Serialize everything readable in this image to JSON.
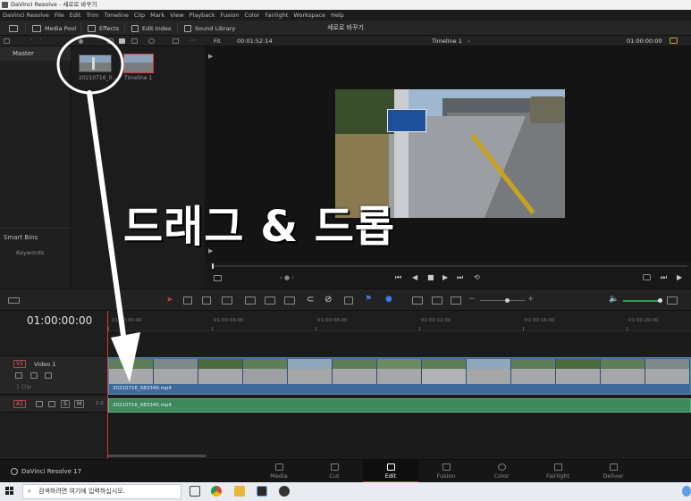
{
  "window": {
    "title": "DaVinci Resolve - 세로로 바꾸기"
  },
  "menu": [
    "DaVinci Resolve",
    "File",
    "Edit",
    "Trim",
    "Timeline",
    "Clip",
    "Mark",
    "View",
    "Playback",
    "Fusion",
    "Color",
    "Fairlight",
    "Workspace",
    "Help"
  ],
  "toolbar": {
    "media_pool": "Media Pool",
    "effects": "Effects",
    "edit_index": "Edit Index",
    "sound_library": "Sound Library",
    "project_name": "세로로 바꾸기"
  },
  "viewer_header": {
    "fit": "Fit",
    "source_timecode": "00:01:52:14",
    "timeline_name": "Timeline 1",
    "record_timecode": "01:00:00:00"
  },
  "bins": {
    "master": "Master",
    "smart_bins": "Smart Bins",
    "keywords": "Keywords"
  },
  "clips": [
    {
      "label": "20210716_0..."
    },
    {
      "label": "Timeline 1"
    }
  ],
  "overlay": {
    "text": "드래그 & 드롭"
  },
  "timeline": {
    "timecode": "01:00:00:00",
    "ruler": [
      "01:00:00:00",
      "01:00:04:00",
      "01:00:08:00",
      "01:00:12:00",
      "01:00:16:00",
      "01:00:20:00"
    ],
    "video_track": {
      "badge": "V1",
      "name": "Video 1",
      "clip_count": "1 Clip",
      "clip_name": "20210716_083340.mp4"
    },
    "audio_track": {
      "badge": "A1",
      "solo": "S",
      "mute": "M",
      "level": "2.0",
      "clip_name": "20210716_083340.mp4"
    }
  },
  "pages": {
    "brand": "DaVinci Resolve 17",
    "tabs": [
      "Media",
      "Cut",
      "Edit",
      "Fusion",
      "Color",
      "Fairlight",
      "Deliver"
    ],
    "active": "Edit"
  },
  "taskbar": {
    "search_placeholder": "검색하려면 여기에 입력하십시오."
  },
  "colors": {
    "accent_red": "#d23a3a",
    "video_clip": "#3e6a99",
    "audio_clip": "#3e8a5e",
    "annotation": "#ffffff"
  }
}
